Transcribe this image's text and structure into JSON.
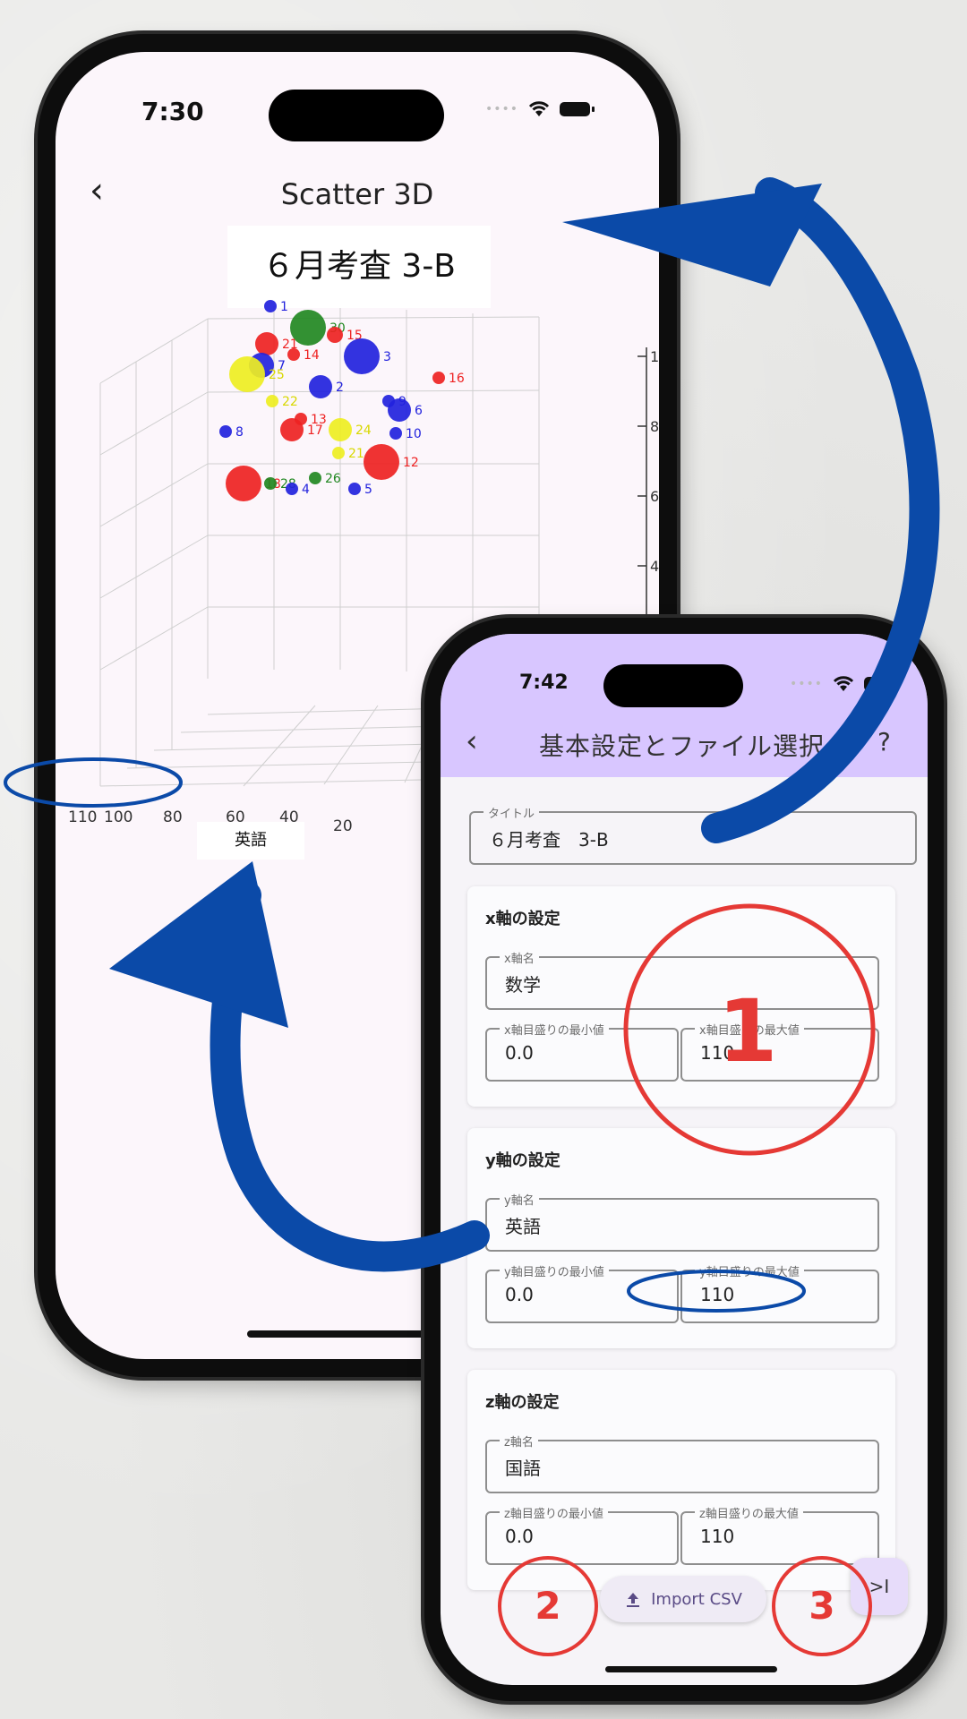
{
  "scatter_screen": {
    "time": "7:30",
    "nav_title": "Scatter 3D",
    "chart_title": "６月考査 3-B",
    "axis_label": "英語",
    "x_ticks": [
      "110",
      "100",
      "80",
      "60",
      "40",
      "20"
    ],
    "z_ticks": [
      "1",
      "8",
      "6",
      "4"
    ],
    "points": [
      {
        "label": "1",
        "color": "#2222dd"
      },
      {
        "label": "30",
        "color": "#228822"
      },
      {
        "label": "15",
        "color": "#ee2222"
      },
      {
        "label": "21",
        "color": "#ee2222"
      },
      {
        "label": "14",
        "color": "#ee2222"
      },
      {
        "label": "3",
        "color": "#2222dd"
      },
      {
        "label": "7",
        "color": "#2222dd"
      },
      {
        "label": "25",
        "color": "#eeee22"
      },
      {
        "label": "16",
        "color": "#ee2222"
      },
      {
        "label": "22",
        "color": "#eeee22"
      },
      {
        "label": "2",
        "color": "#2222dd"
      },
      {
        "label": "9",
        "color": "#2222dd"
      },
      {
        "label": "6",
        "color": "#2222dd"
      },
      {
        "label": "8",
        "color": "#2222dd"
      },
      {
        "label": "13",
        "color": "#ee2222"
      },
      {
        "label": "17",
        "color": "#ee2222"
      },
      {
        "label": "24",
        "color": "#eeee22"
      },
      {
        "label": "10",
        "color": "#2222dd"
      },
      {
        "label": "21",
        "color": "#eeee22"
      },
      {
        "label": "12",
        "color": "#ee2222"
      },
      {
        "label": "18",
        "color": "#ee2222"
      },
      {
        "label": "28",
        "color": "#228822"
      },
      {
        "label": "4",
        "color": "#2222dd"
      },
      {
        "label": "26",
        "color": "#228822"
      },
      {
        "label": "5",
        "color": "#2222dd"
      }
    ]
  },
  "settings_screen": {
    "time": "7:42",
    "nav_title": "基本設定とファイル選択",
    "help": "?",
    "title_field": {
      "label": "タイトル",
      "value": "６月考査　3-B"
    },
    "x_section": {
      "heading": "x軸の設定",
      "name_label": "x軸名",
      "name_value": "数学",
      "min_label": "x軸目盛りの最小値",
      "min_value": "0.0",
      "max_label": "x軸目盛りの最大値",
      "max_value": "110"
    },
    "y_section": {
      "heading": "y軸の設定",
      "name_label": "y軸名",
      "name_value": "英語",
      "min_label": "y軸目盛りの最小値",
      "min_value": "0.0",
      "max_label": "y軸目盛りの最大値",
      "max_value": "110"
    },
    "z_section": {
      "heading": "z軸の設定",
      "name_label": "z軸名",
      "name_value": "国語",
      "min_label": "z軸目盛りの最小値",
      "min_value": "0.0",
      "max_label": "z軸目盛りの最大値",
      "max_value": "110"
    },
    "import_label": "Import CSV",
    "fab_label": ">I"
  },
  "annotations": {
    "badge1": "1",
    "badge2": "2",
    "badge3": "3",
    "arrow_color": "#0b4aa8",
    "badge_color": "#e53935"
  }
}
